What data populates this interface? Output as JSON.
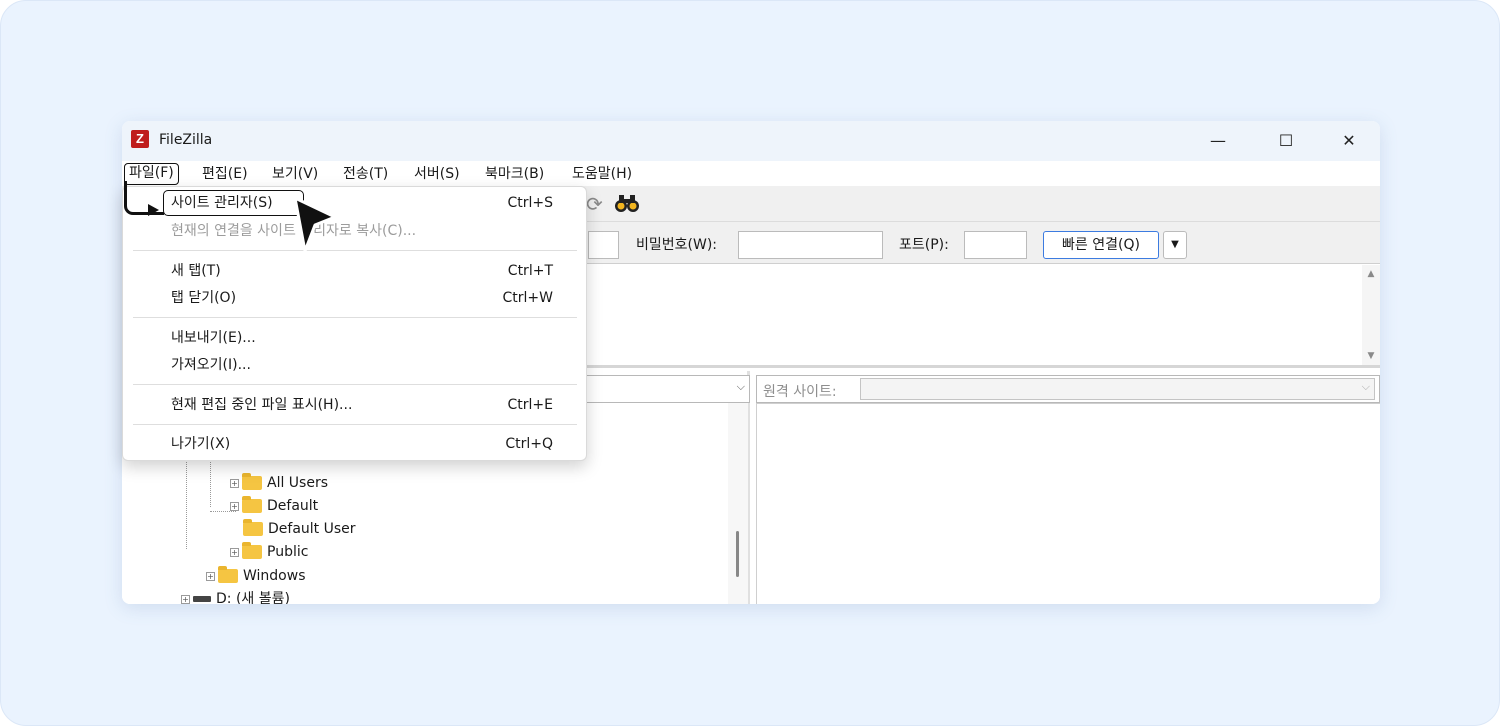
{
  "window": {
    "title": "FileZilla",
    "app_icon": "Z"
  },
  "window_controls": {
    "minimize": "—",
    "maximize": "☐",
    "close": "✕"
  },
  "menubar": {
    "items": [
      {
        "label": "파일(F)"
      },
      {
        "label": "편집(E)"
      },
      {
        "label": "보기(V)"
      },
      {
        "label": "전송(T)"
      },
      {
        "label": "서버(S)"
      },
      {
        "label": "북마크(B)"
      },
      {
        "label": "도움말(H)"
      }
    ]
  },
  "file_menu": {
    "items": [
      {
        "label": "사이트 관리자(S)",
        "shortcut": "Ctrl+S",
        "enabled": true
      },
      {
        "label": "현재의 연결을 사이트 관리자로 복사(C)...",
        "shortcut": "",
        "enabled": false
      },
      {
        "label": "새 탭(T)",
        "shortcut": "Ctrl+T",
        "enabled": true
      },
      {
        "label": "탭 닫기(O)",
        "shortcut": "Ctrl+W",
        "enabled": true
      },
      {
        "label": "내보내기(E)...",
        "shortcut": "",
        "enabled": true
      },
      {
        "label": "가져오기(I)...",
        "shortcut": "",
        "enabled": true
      },
      {
        "label": "현재 편집 중인 파일 표시(H)...",
        "shortcut": "Ctrl+E",
        "enabled": true
      },
      {
        "label": "나가기(X)",
        "shortcut": "Ctrl+Q",
        "enabled": true
      }
    ]
  },
  "quickconnect": {
    "password_label": "비밀번호(W):",
    "port_label": "포트(P):",
    "connect_button": "빠른 연결(Q)",
    "dropdown_icon": "▼"
  },
  "remote": {
    "site_label": "원격 사이트:"
  },
  "local_tree": {
    "items": [
      {
        "label": "All Users",
        "expandable": true
      },
      {
        "label": "Default",
        "expandable": true
      },
      {
        "label": "Default User",
        "expandable": false
      },
      {
        "label": "Public",
        "expandable": true
      },
      {
        "label": "Windows",
        "expandable": true
      },
      {
        "label": "D: (새 볼륨)",
        "expandable": true
      }
    ]
  },
  "colors": {
    "accent": "#3c7be0",
    "app_icon": "#bf1d1d",
    "folder": "#f5c542",
    "background": "#eaf3fe"
  }
}
